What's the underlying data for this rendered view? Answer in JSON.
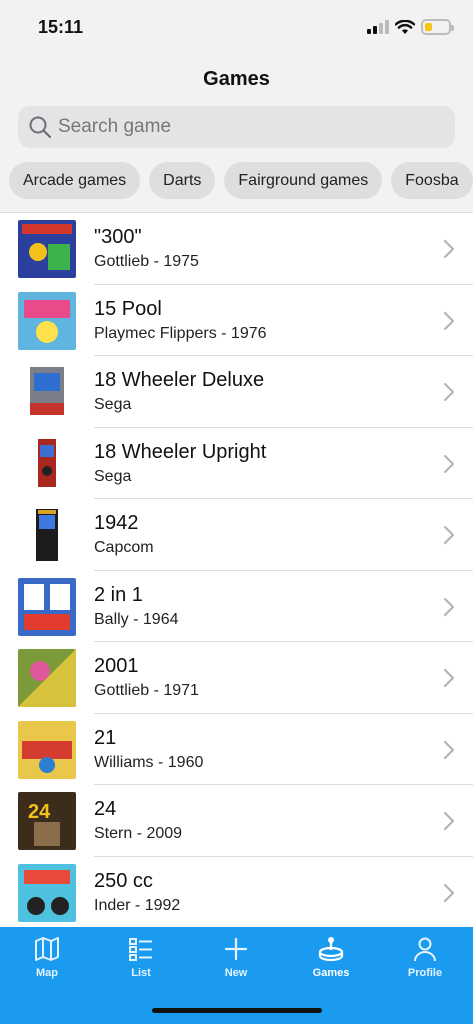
{
  "status": {
    "time": "15:11",
    "battery_level": 0.3
  },
  "nav": {
    "title": "Games"
  },
  "search": {
    "placeholder": "Search game"
  },
  "categories": [
    "Arcade games",
    "Darts",
    "Fairground games",
    "Foosba"
  ],
  "games": [
    {
      "title": "\"300\"",
      "subtitle": "Gottlieb - 1975",
      "thumb": "pinball-backglass-thumbnail"
    },
    {
      "title": "15 Pool",
      "subtitle": "Playmec Flippers - 1976",
      "thumb": "pinball-backglass-thumbnail"
    },
    {
      "title": "18 Wheeler Deluxe",
      "subtitle": "Sega",
      "thumb": "arcade-cabinet-thumbnail"
    },
    {
      "title": "18 Wheeler Upright",
      "subtitle": "Sega",
      "thumb": "arcade-cabinet-thumbnail"
    },
    {
      "title": "1942",
      "subtitle": "Capcom",
      "thumb": "arcade-cabinet-thumbnail"
    },
    {
      "title": "2 in 1",
      "subtitle": "Bally - 1964",
      "thumb": "pinball-backglass-thumbnail"
    },
    {
      "title": "2001",
      "subtitle": "Gottlieb - 1971",
      "thumb": "pinball-backglass-thumbnail"
    },
    {
      "title": "21",
      "subtitle": "Williams - 1960",
      "thumb": "pinball-backglass-thumbnail"
    },
    {
      "title": "24",
      "subtitle": "Stern - 2009",
      "thumb": "pinball-backglass-thumbnail"
    },
    {
      "title": "250 cc",
      "subtitle": "Inder - 1992",
      "thumb": "pinball-backglass-thumbnail"
    }
  ],
  "tabs": [
    {
      "label": "Map",
      "icon": "map-icon"
    },
    {
      "label": "List",
      "icon": "list-icon"
    },
    {
      "label": "New",
      "icon": "plus-icon"
    },
    {
      "label": "Games",
      "icon": "joystick-icon",
      "active": true
    },
    {
      "label": "Profile",
      "icon": "person-icon"
    }
  ],
  "colors": {
    "accent": "#1a9bf0",
    "battery": "#f5c518"
  }
}
